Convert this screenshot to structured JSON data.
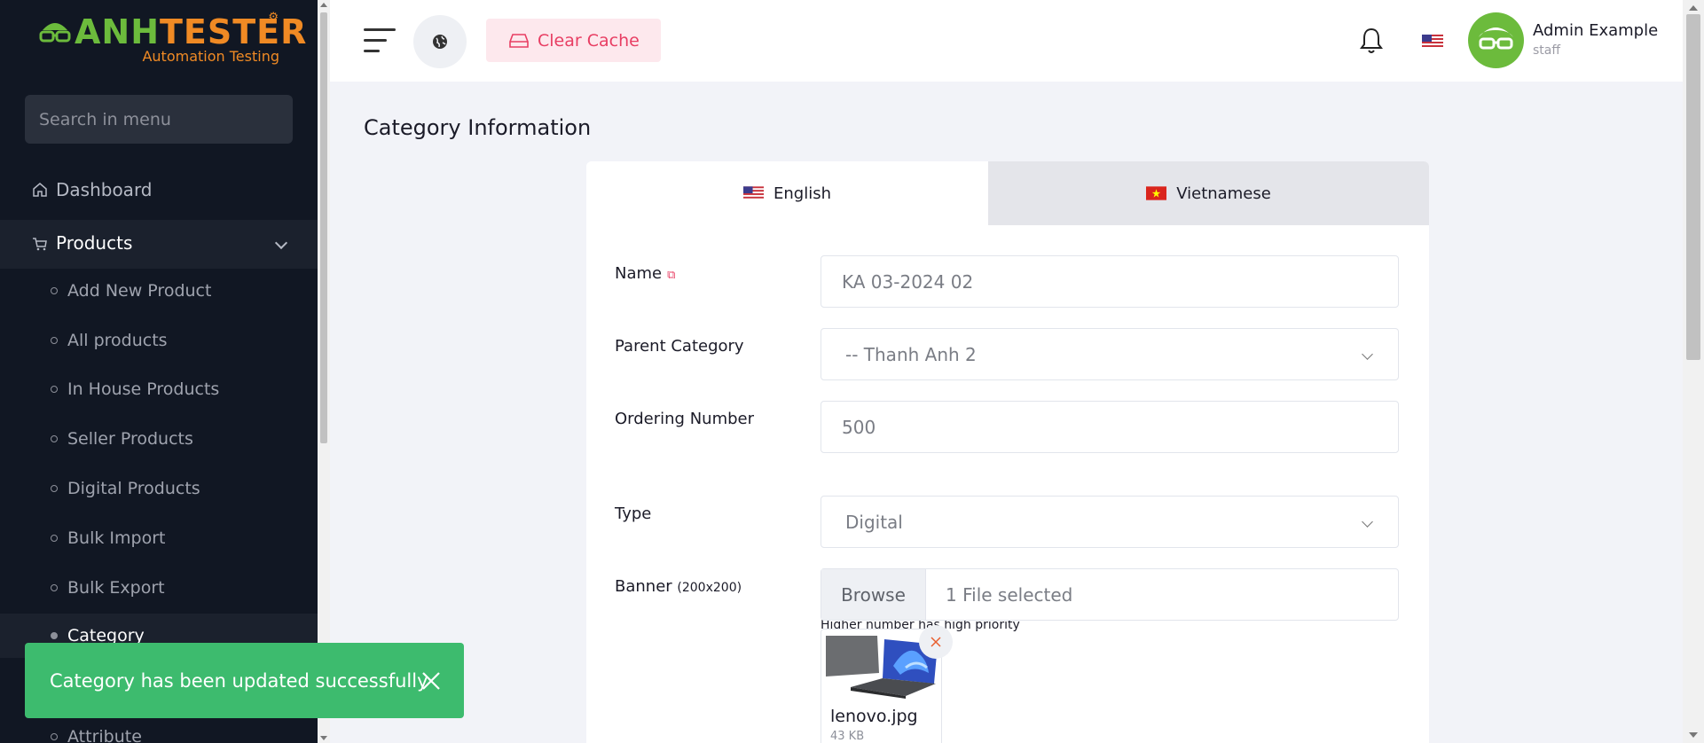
{
  "brand": {
    "name_part1": "ANH",
    "name_part2": "TESTER",
    "tagline": "Automation Testing"
  },
  "sidebar": {
    "search_placeholder": "Search in menu",
    "dashboard_label": "Dashboard",
    "products_label": "Products",
    "sub_items": [
      {
        "label": "Add New Product"
      },
      {
        "label": "All products"
      },
      {
        "label": "In House Products"
      },
      {
        "label": "Seller Products"
      },
      {
        "label": "Digital Products"
      },
      {
        "label": "Bulk Import"
      },
      {
        "label": "Bulk Export"
      },
      {
        "label": "Category"
      },
      {
        "label": "Attribute"
      }
    ]
  },
  "topbar": {
    "clear_cache_label": "Clear Cache",
    "user_name": "Admin Example",
    "user_role": "staff"
  },
  "page": {
    "title": "Category Information"
  },
  "tabs": [
    {
      "label": "English"
    },
    {
      "label": "Vietnamese"
    }
  ],
  "form": {
    "name_label": "Name",
    "name_value": "KA 03-2024 02",
    "parent_label": "Parent Category",
    "parent_value": "-- Thanh Anh 2",
    "ordering_label": "Ordering Number",
    "ordering_value": "500",
    "ordering_hint": "Higher number has high priority",
    "type_label": "Type",
    "type_value": "Digital",
    "banner_label": "Banner",
    "banner_size": "(200x200)",
    "browse_label": "Browse",
    "file_status": "1 File selected",
    "file_name": "lenovo.jpg",
    "file_size": "43 KB"
  },
  "toast": {
    "message": "Category has been updated successfully"
  },
  "colors": {
    "sidebar_bg": "#111723",
    "accent_green": "#6cbb3c",
    "accent_orange": "#f08a24",
    "danger": "#e83e63",
    "toast_bg": "#3dbb6e"
  }
}
